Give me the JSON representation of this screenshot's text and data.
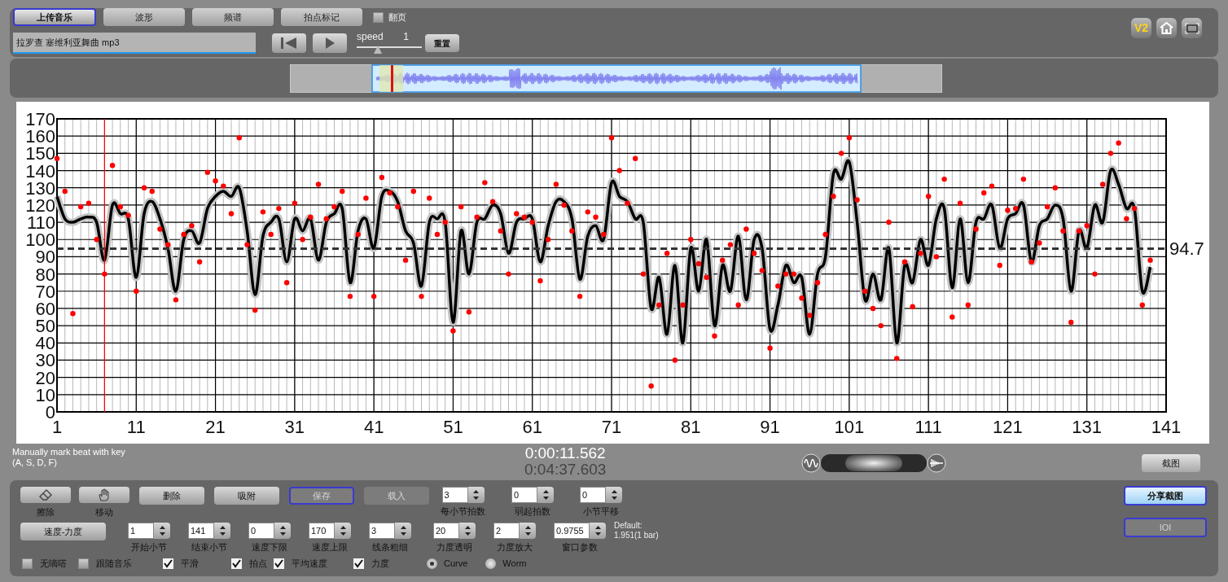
{
  "tabs": [
    {
      "label": "上传音乐",
      "selected": true
    },
    {
      "label": "波形",
      "selected": false
    },
    {
      "label": "频谱",
      "selected": false
    },
    {
      "label": "拍点标记",
      "selected": false
    }
  ],
  "page_flip": {
    "label": "翻页",
    "checked": false
  },
  "file_field": {
    "value": "拉罗查  塞维利亚舞曲 mp3"
  },
  "speed": {
    "label": "speed",
    "value": "1",
    "level": 0.32
  },
  "reset_button": "重置",
  "version_badge": "V2",
  "chart": {
    "chart_data": {
      "type": "line",
      "x": [
        1,
        2,
        3,
        4,
        5,
        6,
        7,
        8,
        9,
        10,
        11,
        12,
        13,
        14,
        15,
        16,
        17,
        18,
        19,
        20,
        21,
        22,
        23,
        24,
        25,
        26,
        27,
        28,
        29,
        30,
        31,
        32,
        33,
        34,
        35,
        36,
        37,
        38,
        39,
        40,
        41,
        42,
        43,
        44,
        45,
        46,
        47,
        48,
        49,
        50,
        51,
        52,
        53,
        54,
        55,
        56,
        57,
        58,
        59,
        60,
        61,
        62,
        63,
        64,
        65,
        66,
        67,
        68,
        69,
        70,
        71,
        72,
        73,
        74,
        75,
        76,
        77,
        78,
        79,
        80,
        81,
        82,
        83,
        84,
        85,
        86,
        87,
        88,
        89,
        90,
        91,
        92,
        93,
        94,
        95,
        96,
        97,
        98,
        99,
        100,
        101,
        102,
        103,
        104,
        105,
        106,
        107,
        108,
        109,
        110,
        111,
        112,
        113,
        114,
        115,
        116,
        117,
        118,
        119,
        120,
        121,
        122,
        123,
        124,
        125,
        126,
        127,
        128,
        129,
        130,
        131,
        132,
        133,
        134,
        135,
        136,
        137,
        138,
        139
      ],
      "series": [
        {
          "color": "#000000",
          "values": [
            125,
            112,
            110,
            112,
            113,
            110,
            88,
            120,
            115,
            112,
            78,
            115,
            122,
            112,
            95,
            70,
            100,
            105,
            98,
            118,
            125,
            128,
            125,
            130,
            105,
            68,
            102,
            110,
            112,
            87,
            112,
            105,
            112,
            88,
            110,
            115,
            118,
            75,
            105,
            112,
            95,
            125,
            128,
            122,
            105,
            98,
            73,
            110,
            112,
            110,
            52,
            105,
            80,
            110,
            112,
            120,
            115,
            92,
            110,
            112,
            112,
            87,
            108,
            122,
            122,
            112,
            77,
            102,
            108,
            100,
            133,
            125,
            122,
            112,
            110,
            60,
            78,
            45,
            85,
            40,
            95,
            70,
            100,
            50,
            85,
            70,
            102,
            65,
            100,
            95,
            48,
            62,
            85,
            75,
            78,
            45,
            80,
            90,
            138,
            135,
            145,
            110,
            65,
            80,
            65,
            95,
            40,
            85,
            75,
            100,
            85,
            112,
            118,
            72,
            112,
            75,
            110,
            112,
            120,
            95,
            112,
            115,
            120,
            87,
            108,
            112,
            120,
            112,
            70,
            105,
            95,
            120,
            110,
            140,
            132,
            118,
            118,
            70,
            84
          ]
        }
      ],
      "xlim": [
        1,
        141
      ],
      "ylim": [
        0,
        170
      ],
      "grid": true,
      "xticks": [
        1,
        11,
        21,
        31,
        41,
        51,
        61,
        71,
        81,
        91,
        101,
        111,
        121,
        131,
        141
      ],
      "yticks": [
        0,
        10,
        20,
        30,
        40,
        50,
        60,
        70,
        80,
        90,
        100,
        110,
        120,
        130,
        140,
        150,
        160,
        170
      ],
      "ref_lines": [
        {
          "axis": "y",
          "value": 94.7,
          "label": "94.7"
        },
        {
          "axis": "x",
          "value": 7
        }
      ]
    }
  },
  "beat_marks": {
    "chart_data": {
      "type": "scatter",
      "x": [
        1,
        2,
        3,
        4,
        5,
        6,
        7,
        8,
        9,
        10,
        11,
        12,
        13,
        14,
        15,
        16,
        17,
        18,
        19,
        20,
        21,
        22,
        23,
        24,
        25,
        26,
        27,
        28,
        29,
        30,
        31,
        32,
        33,
        34,
        35,
        36,
        37,
        38,
        39,
        40,
        41,
        42,
        43,
        44,
        45,
        46,
        47,
        48,
        49,
        50,
        51,
        52,
        53,
        54,
        55,
        56,
        57,
        58,
        59,
        60,
        61,
        62,
        63,
        64,
        65,
        66,
        67,
        68,
        69,
        70,
        71,
        72,
        73,
        74,
        75,
        76,
        77,
        78,
        79,
        80,
        81,
        82,
        83,
        84,
        85,
        86,
        87,
        88,
        89,
        90,
        91,
        92,
        93,
        94,
        95,
        96,
        97,
        98,
        99,
        100,
        101,
        102,
        103,
        104,
        105,
        106,
        107,
        108,
        109,
        110,
        111,
        112,
        113,
        114,
        115,
        116,
        117,
        118,
        119,
        120,
        121,
        122,
        123,
        124,
        125,
        126,
        127,
        128,
        129,
        130,
        131,
        132,
        133,
        134,
        135,
        136,
        137,
        138,
        139
      ],
      "series": [
        {
          "color": "#ff0000",
          "values": [
            147,
            128,
            57,
            119,
            121,
            100,
            80,
            143,
            119,
            114,
            70,
            130,
            128,
            106,
            97,
            65,
            103,
            108,
            87,
            139,
            134,
            131,
            115,
            159,
            97,
            59,
            116,
            103,
            118,
            75,
            121,
            100,
            113,
            132,
            112,
            119,
            128,
            67,
            103,
            124,
            67,
            136,
            127,
            119,
            88,
            128,
            67,
            124,
            103,
            110,
            47,
            119,
            58,
            113,
            133,
            122,
            105,
            80,
            115,
            113,
            110,
            76,
            100,
            132,
            120,
            105,
            67,
            116,
            113,
            103,
            159,
            140,
            121,
            147,
            80,
            15,
            62,
            92,
            30,
            62,
            100,
            86,
            78,
            44,
            88,
            97,
            62,
            106,
            92,
            82,
            37,
            73,
            80,
            80,
            66,
            56,
            75,
            103,
            125,
            150,
            159,
            123,
            70,
            60,
            50,
            110,
            31,
            87,
            61,
            92,
            125,
            90,
            135,
            55,
            121,
            62,
            106,
            127,
            131,
            85,
            117,
            118,
            135,
            87,
            98,
            119,
            130,
            105,
            52,
            105,
            108,
            80,
            132,
            150,
            156,
            112,
            118,
            62,
            88
          ]
        }
      ],
      "xlim": [
        1,
        141
      ],
      "ylim": [
        0,
        170
      ]
    }
  },
  "hint": [
    "Manually mark beat with key",
    "(A, S, D, F)"
  ],
  "times": {
    "current": "0:00:11.562",
    "total": "0:04:37.603"
  },
  "screenshot_button": "截图",
  "zoom": {
    "level": 0.5
  },
  "tool_buttons": [
    {
      "kind": "icon",
      "label": "擦除"
    },
    {
      "kind": "icon",
      "label": "移动"
    },
    {
      "kind": "text",
      "label": "删除",
      "disabled": false,
      "focused": false
    },
    {
      "kind": "text",
      "label": "吸附",
      "disabled": false,
      "focused": false
    },
    {
      "kind": "text",
      "label": "保存",
      "disabled": true,
      "focused": true
    },
    {
      "kind": "text",
      "label": "载入",
      "disabled": true,
      "focused": false
    }
  ],
  "spinners_top": [
    {
      "value": "3",
      "label": "每小节拍数"
    },
    {
      "value": "0",
      "label": "弱起拍数"
    },
    {
      "value": "0",
      "label": "小节平移"
    }
  ],
  "mode_button": "速度-力度",
  "spinners_bottom": [
    {
      "value": "1",
      "label": "开始小节"
    },
    {
      "value": "141",
      "label": "结束小节"
    },
    {
      "value": "0",
      "label": "速度下限"
    },
    {
      "value": "170",
      "label": "速度上限"
    },
    {
      "value": "3",
      "label": "线条粗细"
    },
    {
      "value": "20",
      "label": "力度透明"
    },
    {
      "value": "2",
      "label": "力度放大"
    },
    {
      "value": "0.9755",
      "label": "窗口参数"
    }
  ],
  "default_note": [
    "Default:",
    "1.951(1 bar)"
  ],
  "checkboxes": [
    {
      "label": "无嘀嗒",
      "checked": false
    },
    {
      "label": "跟随音乐",
      "checked": false
    },
    {
      "label": "平滑",
      "checked": true
    },
    {
      "label": "拍点",
      "checked": true
    },
    {
      "label": "平均速度",
      "checked": true
    },
    {
      "label": "力度",
      "checked": true
    }
  ],
  "radios": [
    {
      "label": "Curve",
      "selected": true
    },
    {
      "label": "Worm",
      "selected": false
    }
  ],
  "right_buttons": [
    {
      "label": "分享截图",
      "disabled": false
    },
    {
      "label": "IOI",
      "disabled": true
    }
  ]
}
